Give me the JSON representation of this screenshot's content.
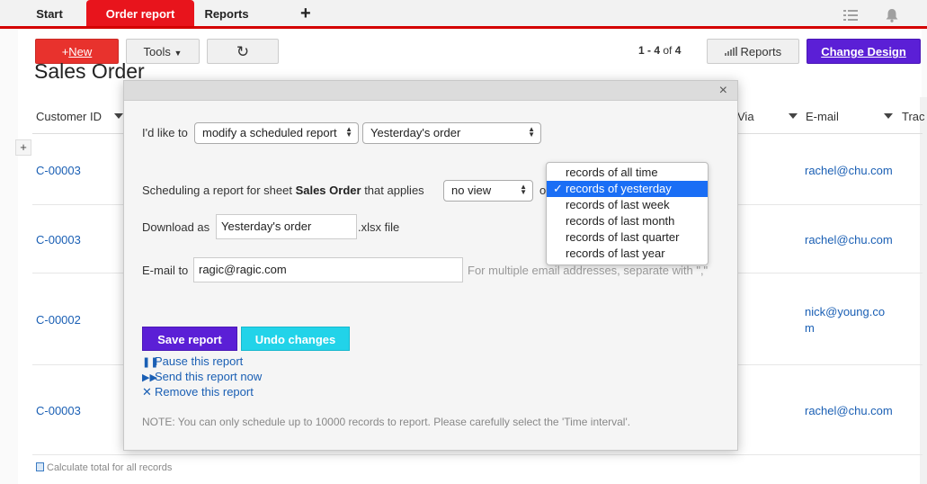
{
  "tabs": [
    {
      "label": "Start",
      "active": false
    },
    {
      "label": "Order report",
      "active": true
    },
    {
      "label": "Reports",
      "active": false
    }
  ],
  "tab_add": "+",
  "toolbar": {
    "new_prefix": "+",
    "new_label": "New",
    "tools_label": "Tools",
    "refresh_glyph": "↻",
    "pager_range": "1 - 4",
    "pager_of": "of",
    "pager_total": "4",
    "reports_label": "Reports",
    "change_design_label": "Change Design"
  },
  "sheet_title": "Sales Order",
  "table": {
    "headers": [
      "Customer ID",
      "Via",
      "E-mail",
      "Trac"
    ],
    "rows": [
      {
        "customer_id": "C-00003",
        "email": "rachel@chu.com"
      },
      {
        "customer_id": "C-00003",
        "email": "rachel@chu.com"
      },
      {
        "customer_id": "C-00002",
        "email_line1": "nick@young.co",
        "email_line2": "m"
      },
      {
        "customer_id": "C-00003",
        "email": "rachel@chu.com"
      }
    ],
    "calc_total": "Calculate total for all records"
  },
  "modal": {
    "close_glyph": "×",
    "like_label": "I'd like to",
    "action_select": "modify a scheduled report",
    "report_select": "Yesterday's order",
    "schedule_prefix": "Scheduling a report for sheet",
    "sheet_name": "Sales Order",
    "schedule_suffix": "that applies",
    "view_select": "no view",
    "on_fragment": "o",
    "download_label": "Download as",
    "download_value": "Yesterday's order",
    "download_ext": ".xlsx file",
    "email_label": "E-mail to",
    "email_value": "ragic@ragic.com",
    "email_hint": "For multiple email addresses, separate with \",\"",
    "save_label": "Save report",
    "undo_label": "Undo changes",
    "pause_label": "Pause this report",
    "send_label": "Send this report now",
    "remove_label": "Remove this report",
    "note": "NOTE: You can only schedule up to 10000 records to report. Please carefully select the 'Time interval'."
  },
  "time_interval": {
    "options": [
      "records of all time",
      "records of yesterday",
      "records of last week",
      "records of last month",
      "records of last quarter",
      "records of last year"
    ],
    "selected": "records of yesterday"
  },
  "colors": {
    "accent_red": "#e8141c",
    "primary_purple": "#5b1fd6",
    "cyan": "#22d3e9",
    "link_blue": "#1a5fb4",
    "select_blue": "#1a6ef5"
  }
}
